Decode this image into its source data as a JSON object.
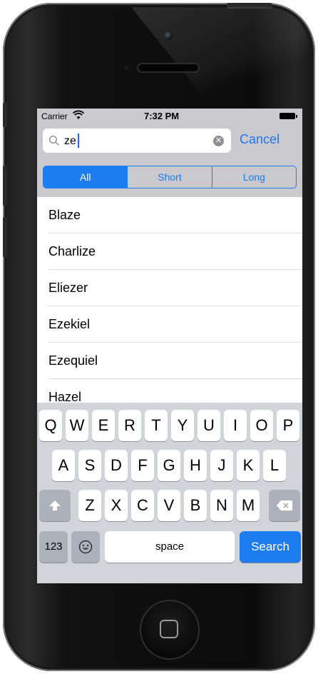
{
  "status_bar": {
    "carrier": "Carrier",
    "time": "7:32 PM"
  },
  "search": {
    "query": "ze",
    "cancel_label": "Cancel"
  },
  "scope": {
    "options": [
      "All",
      "Short",
      "Long"
    ],
    "selected": "All"
  },
  "results": [
    "Blaze",
    "Charlize",
    "Eliezer",
    "Ezekiel",
    "Ezequiel",
    "Hazel"
  ],
  "keyboard": {
    "row1": [
      "Q",
      "W",
      "E",
      "R",
      "T",
      "Y",
      "U",
      "I",
      "O",
      "P"
    ],
    "row2": [
      "A",
      "S",
      "D",
      "F",
      "G",
      "H",
      "J",
      "K",
      "L"
    ],
    "row3": [
      "Z",
      "X",
      "C",
      "V",
      "B",
      "N",
      "M"
    ],
    "numbers_label": "123",
    "space_label": "space",
    "search_label": "Search"
  },
  "colors": {
    "accent": "#1c7cf0",
    "search_bar_bg": "#c9c9ce",
    "keyboard_bg": "#d1d4d9"
  },
  "icons": [
    "wifi-icon",
    "battery-icon",
    "magnifier-icon",
    "clear-icon",
    "shift-icon",
    "emoji-icon",
    "backspace-icon",
    "home-icon"
  ]
}
